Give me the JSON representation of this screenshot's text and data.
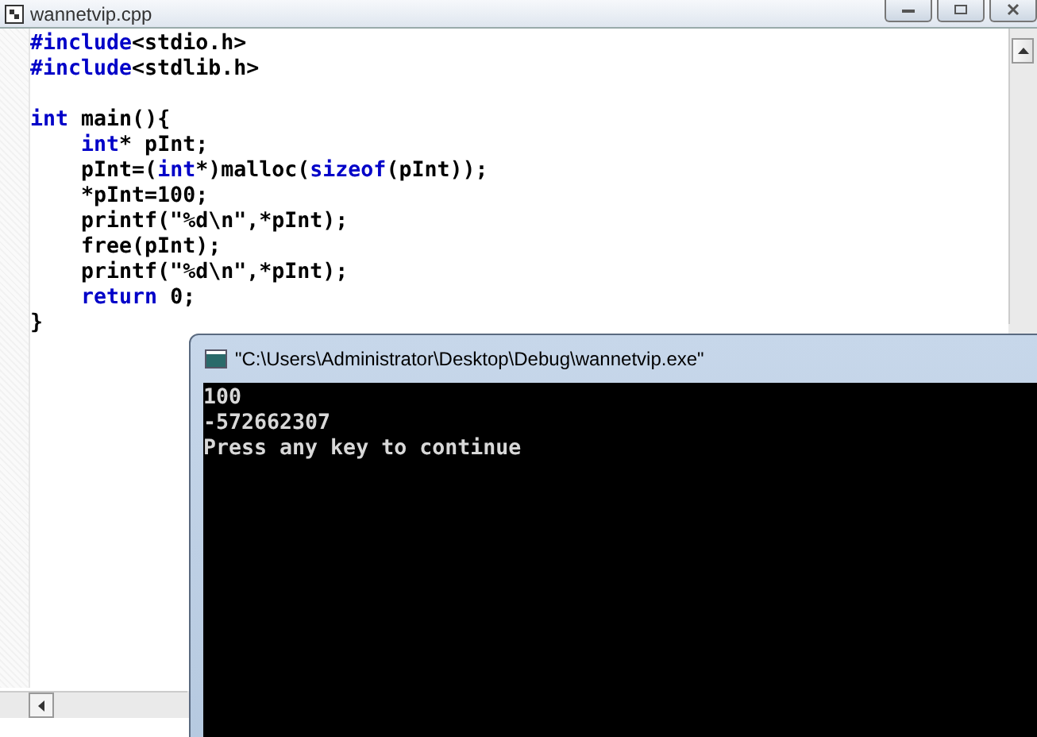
{
  "editor": {
    "title": "wannetvip.cpp",
    "lines": [
      {
        "kind": "code",
        "tokens": [
          {
            "kind": "kw",
            "text": "#include"
          },
          {
            "kind": "text",
            "text": "<stdio.h>"
          }
        ]
      },
      {
        "kind": "code",
        "tokens": [
          {
            "kind": "kw",
            "text": "#include"
          },
          {
            "kind": "text",
            "text": "<stdlib.h>"
          }
        ]
      },
      {
        "kind": "blank"
      },
      {
        "kind": "code",
        "tokens": [
          {
            "kind": "kw",
            "text": "int"
          },
          {
            "kind": "text",
            "text": " main(){"
          }
        ]
      },
      {
        "kind": "code",
        "tokens": [
          {
            "kind": "kw",
            "text": "    int"
          },
          {
            "kind": "text",
            "text": "* pInt;"
          }
        ]
      },
      {
        "kind": "code",
        "tokens": [
          {
            "kind": "text",
            "text": "    pInt=("
          },
          {
            "kind": "kw",
            "text": "int"
          },
          {
            "kind": "text",
            "text": "*)malloc("
          },
          {
            "kind": "kw",
            "text": "sizeof"
          },
          {
            "kind": "text",
            "text": "(pInt));"
          }
        ]
      },
      {
        "kind": "code",
        "tokens": [
          {
            "kind": "text",
            "text": "    *pInt=100;"
          }
        ]
      },
      {
        "kind": "code",
        "tokens": [
          {
            "kind": "text",
            "text": "    printf(\"%d\\n\",*pInt);"
          }
        ]
      },
      {
        "kind": "code",
        "tokens": [
          {
            "kind": "text",
            "text": "    free(pInt);"
          }
        ]
      },
      {
        "kind": "code",
        "tokens": [
          {
            "kind": "text",
            "text": "    printf(\"%d\\n\",*pInt);"
          }
        ]
      },
      {
        "kind": "code",
        "tokens": [
          {
            "kind": "kw",
            "text": "    return"
          },
          {
            "kind": "text",
            "text": " 0;"
          }
        ]
      },
      {
        "kind": "code",
        "tokens": [
          {
            "kind": "text",
            "text": "}"
          }
        ]
      }
    ]
  },
  "console": {
    "title": "\"C:\\Users\\Administrator\\Desktop\\Debug\\wannetvip.exe\"",
    "lines": [
      "100",
      "-572662307",
      "Press any key to continue"
    ]
  }
}
